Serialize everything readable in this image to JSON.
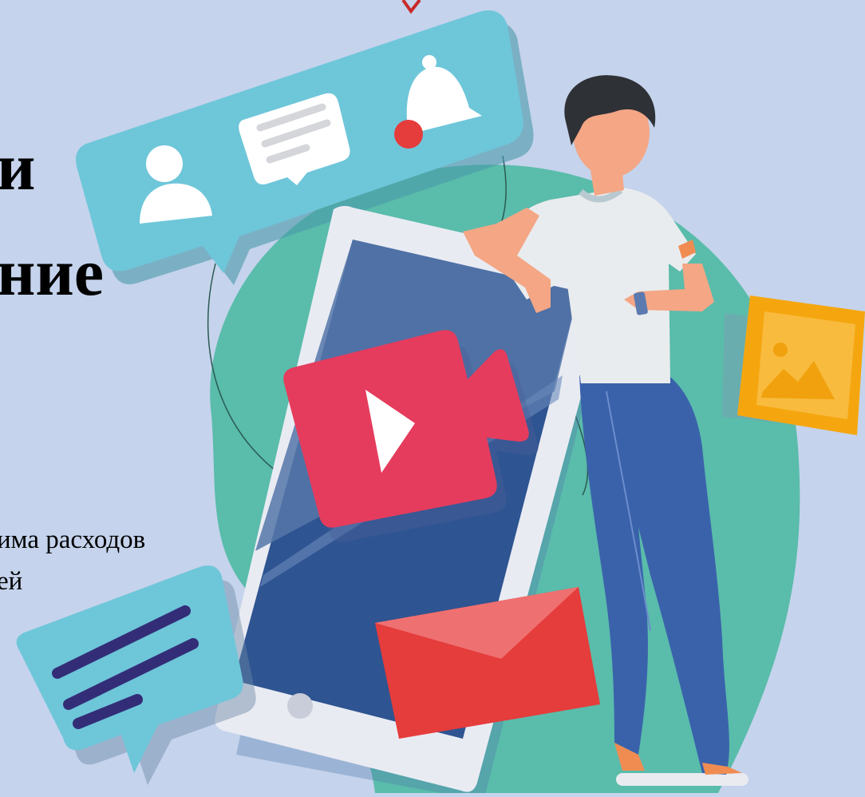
{
  "text": {
    "heading_line_1": "и",
    "heading_line_2": "ние",
    "body_line_1": "има расходов",
    "body_line_2": "ей"
  },
  "colors": {
    "background": "#c5d3ec",
    "blob": "#5abcab",
    "notification_bubble": "#6ec6d9",
    "video_icon": "#e53c5d",
    "envelope": "#e53c3c",
    "image_card": "#f5a60f",
    "phone_screen": "#2e5491",
    "jeans": "#3a62ab",
    "shirt": "#e9ecee",
    "skin": "#f4a685",
    "hair": "#2e3136",
    "text_lines": "#332d78",
    "alert_dot": "#e53c3c"
  },
  "icons": [
    "person-icon",
    "chat-icon",
    "bell-icon",
    "play-icon",
    "mountain-icon"
  ]
}
